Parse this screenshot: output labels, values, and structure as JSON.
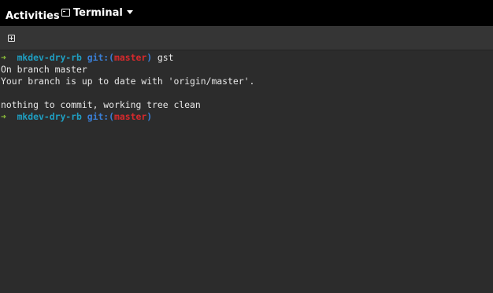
{
  "topbar": {
    "activities_label": "Activities",
    "app_name": "Terminal",
    "app_icon": "terminal-icon"
  },
  "headerbar": {
    "new_tab_icon": "new-tab-icon"
  },
  "terminal": {
    "prompt_arrow": "➜",
    "directory": "mkdev-dry-rb",
    "git_prefix": "git:(",
    "branch": "master",
    "git_suffix": ")",
    "command": "gst",
    "output_1": "On branch master",
    "output_2": "Your branch is up to date with 'origin/master'.",
    "output_3": "nothing to commit, working tree clean",
    "colors": {
      "background": "#2c2c2c",
      "arrow": "#8ec23a",
      "directory": "#1f9fc2",
      "git": "#3a7fd6",
      "branch": "#d8292c",
      "text": "#e8e8e8"
    }
  }
}
